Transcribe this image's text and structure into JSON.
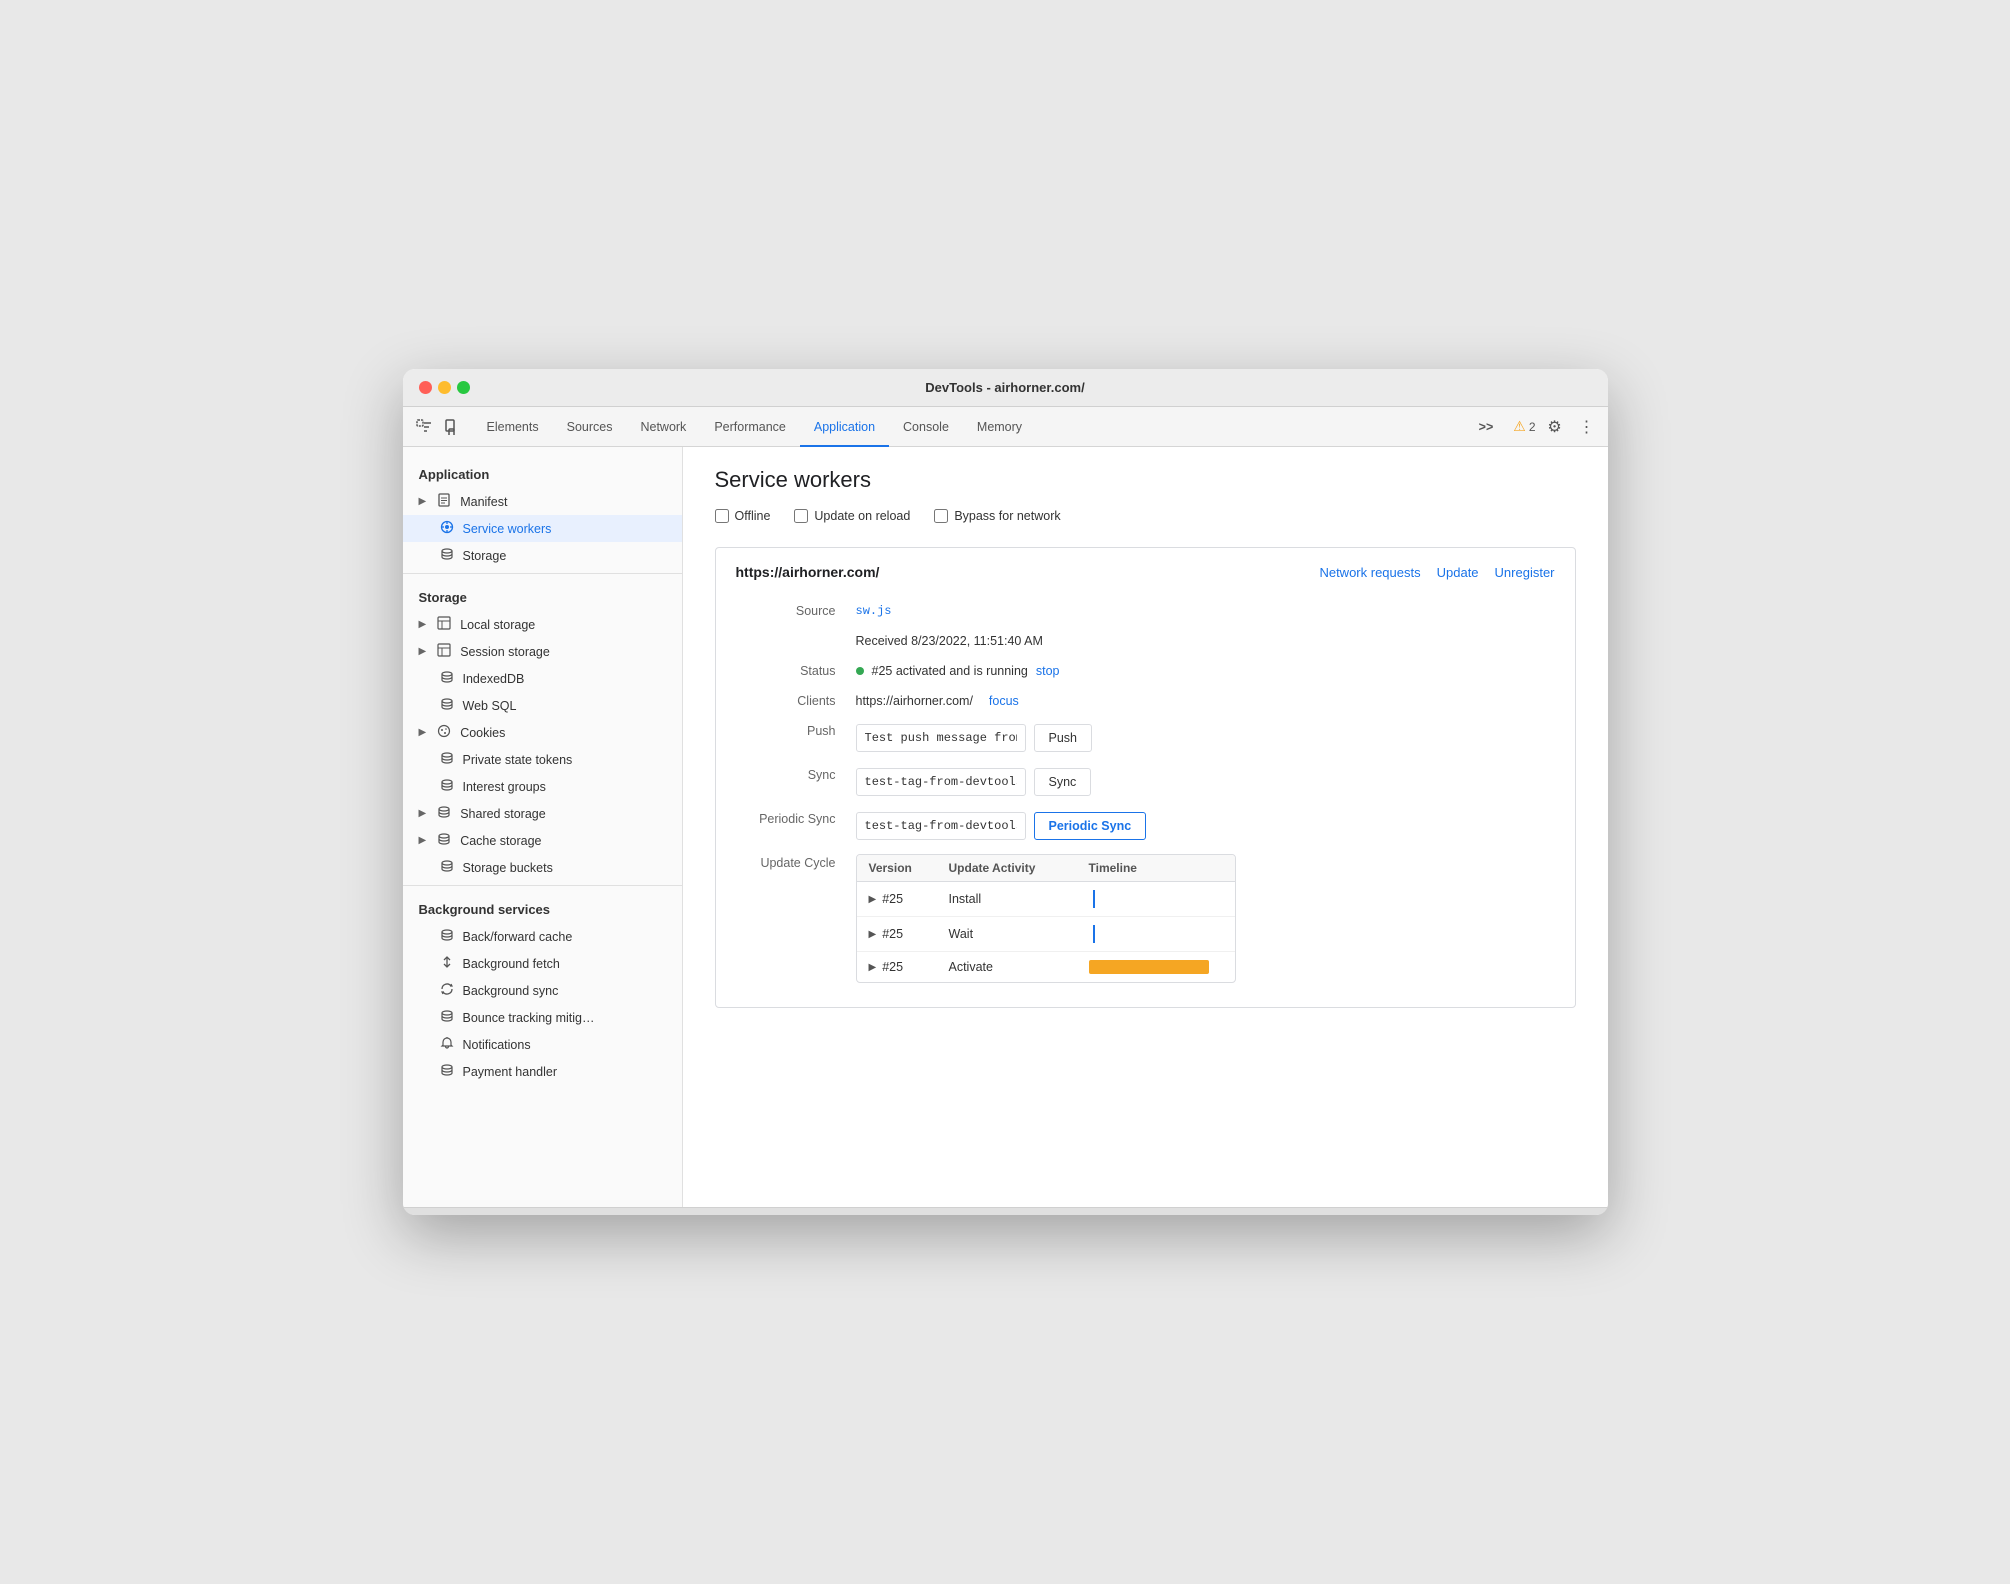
{
  "window": {
    "title": "DevTools - airhorner.com/"
  },
  "toolbar": {
    "tabs": [
      {
        "id": "elements",
        "label": "Elements",
        "active": false
      },
      {
        "id": "sources",
        "label": "Sources",
        "active": false
      },
      {
        "id": "network",
        "label": "Network",
        "active": false
      },
      {
        "id": "performance",
        "label": "Performance",
        "active": false
      },
      {
        "id": "application",
        "label": "Application",
        "active": true
      },
      {
        "id": "console",
        "label": "Console",
        "active": false
      },
      {
        "id": "memory",
        "label": "Memory",
        "active": false
      }
    ],
    "more_tabs": ">>",
    "warning_count": "2",
    "gear_icon": "⚙",
    "more_icon": "⋮"
  },
  "sidebar": {
    "sections": [
      {
        "id": "application",
        "label": "Application",
        "items": [
          {
            "id": "manifest",
            "label": "Manifest",
            "icon": "📄",
            "hasArrow": true,
            "indent": false
          },
          {
            "id": "service-workers",
            "label": "Service workers",
            "icon": "⚙",
            "hasArrow": false,
            "active": true,
            "indent": false
          },
          {
            "id": "storage",
            "label": "Storage",
            "icon": "🗄",
            "hasArrow": false,
            "indent": false
          }
        ]
      },
      {
        "id": "storage",
        "label": "Storage",
        "items": [
          {
            "id": "local-storage",
            "label": "Local storage",
            "icon": "⊞",
            "hasArrow": true,
            "indent": false
          },
          {
            "id": "session-storage",
            "label": "Session storage",
            "icon": "⊞",
            "hasArrow": true,
            "indent": false
          },
          {
            "id": "indexeddb",
            "label": "IndexedDB",
            "icon": "🗄",
            "hasArrow": false,
            "indent": false
          },
          {
            "id": "web-sql",
            "label": "Web SQL",
            "icon": "🗄",
            "hasArrow": false,
            "indent": false
          },
          {
            "id": "cookies",
            "label": "Cookies",
            "icon": "🍪",
            "hasArrow": true,
            "indent": false
          },
          {
            "id": "private-state-tokens",
            "label": "Private state tokens",
            "icon": "🗄",
            "hasArrow": false,
            "indent": false
          },
          {
            "id": "interest-groups",
            "label": "Interest groups",
            "icon": "🗄",
            "hasArrow": false,
            "indent": false
          },
          {
            "id": "shared-storage",
            "label": "Shared storage",
            "icon": "🗄",
            "hasArrow": true,
            "indent": false
          },
          {
            "id": "cache-storage",
            "label": "Cache storage",
            "icon": "🗄",
            "hasArrow": true,
            "indent": false
          },
          {
            "id": "storage-buckets",
            "label": "Storage buckets",
            "icon": "🗄",
            "hasArrow": false,
            "indent": false
          }
        ]
      },
      {
        "id": "background-services",
        "label": "Background services",
        "items": [
          {
            "id": "back-forward-cache",
            "label": "Back/forward cache",
            "icon": "🗄",
            "hasArrow": false,
            "indent": false
          },
          {
            "id": "background-fetch",
            "label": "Background fetch",
            "icon": "↕",
            "hasArrow": false,
            "indent": false
          },
          {
            "id": "background-sync",
            "label": "Background sync",
            "icon": "↻",
            "hasArrow": false,
            "indent": false
          },
          {
            "id": "bounce-tracking",
            "label": "Bounce tracking mitig…",
            "icon": "🗄",
            "hasArrow": false,
            "indent": false
          },
          {
            "id": "notifications",
            "label": "Notifications",
            "icon": "🔔",
            "hasArrow": false,
            "indent": false
          },
          {
            "id": "payment-handler",
            "label": "Payment handler",
            "icon": "🗄",
            "hasArrow": false,
            "indent": false
          }
        ]
      }
    ]
  },
  "main": {
    "title": "Service workers",
    "checkboxes": [
      {
        "id": "offline",
        "label": "Offline",
        "checked": false
      },
      {
        "id": "update-on-reload",
        "label": "Update on reload",
        "checked": false
      },
      {
        "id": "bypass-for-network",
        "label": "Bypass for network",
        "checked": false
      }
    ],
    "sw_url": "https://airhorner.com/",
    "links": [
      {
        "id": "network-requests",
        "label": "Network requests"
      },
      {
        "id": "update",
        "label": "Update"
      },
      {
        "id": "unregister",
        "label": "Unregister"
      }
    ],
    "fields": {
      "source_label": "Source",
      "source_value": "sw.js",
      "received": "Received 8/23/2022, 11:51:40 AM",
      "status_label": "Status",
      "status_text": "#25 activated and is running",
      "stop_label": "stop",
      "clients_label": "Clients",
      "clients_url": "https://airhorner.com/",
      "focus_label": "focus",
      "push_label": "Push",
      "push_placeholder": "Test push message from DevTools.",
      "push_btn": "Push",
      "sync_label": "Sync",
      "sync_placeholder": "test-tag-from-devtools",
      "sync_btn": "Sync",
      "periodic_sync_label": "Periodic Sync",
      "periodic_sync_placeholder": "test-tag-from-devtools",
      "periodic_sync_btn": "Periodic Sync",
      "update_cycle_label": "Update Cycle"
    },
    "update_cycle": {
      "headers": [
        "Version",
        "Update Activity",
        "Timeline"
      ],
      "rows": [
        {
          "version": "#25",
          "activity": "Install",
          "timeline_type": "line"
        },
        {
          "version": "#25",
          "activity": "Wait",
          "timeline_type": "line"
        },
        {
          "version": "#25",
          "activity": "Activate",
          "timeline_type": "bar"
        }
      ]
    }
  }
}
